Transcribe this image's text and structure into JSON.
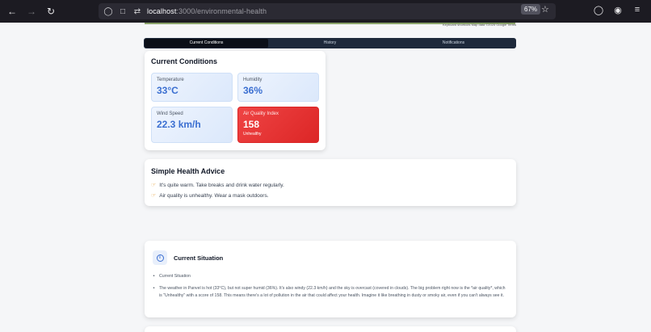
{
  "browser": {
    "url_host": "localhost",
    "url_path": ":3000/environmental-health",
    "zoom": "67%"
  },
  "map": {
    "attribution": "Keyboard shortcuts  Map data ©2025 Google  Terms"
  },
  "tabs": [
    {
      "label": "Current Conditions",
      "active": true
    },
    {
      "label": "History",
      "active": false
    },
    {
      "label": "Notifications",
      "active": false
    }
  ],
  "conditions": {
    "title": "Current Conditions",
    "temperature": {
      "label": "Temperature",
      "value": "33°C"
    },
    "humidity": {
      "label": "Humidity",
      "value": "36%"
    },
    "wind": {
      "label": "Wind Speed",
      "value": "22.3 km/h"
    },
    "aqi": {
      "label": "Air Quality Index",
      "value": "158",
      "status": "Unhealthy",
      "color": "#ef4444"
    }
  },
  "advice": {
    "title": "Simple Health Advice",
    "items": [
      "It's quite warm. Take breaks and drink water regularly.",
      "Air quality is unhealthy. Wear a mask outdoors."
    ]
  },
  "situation": {
    "title": "Current Situation",
    "items": [
      "Current Situation",
      "The weather in Panvel is hot (33°C), but not super humid (36%). It's also windy (22.3 km/h) and the sky is overcast (covered in clouds). The big problem right now is the *air quality*, which is \"Unhealthy\" with a score of 158. This means there's a lot of pollution in the air that could affect your health. Imagine it like breathing in dusty or smoky air, even if you can't always see it."
    ]
  },
  "colors": {
    "accent": "#3b6fd1",
    "tab_bar": "#1e293b",
    "alert": "#ef4444"
  }
}
